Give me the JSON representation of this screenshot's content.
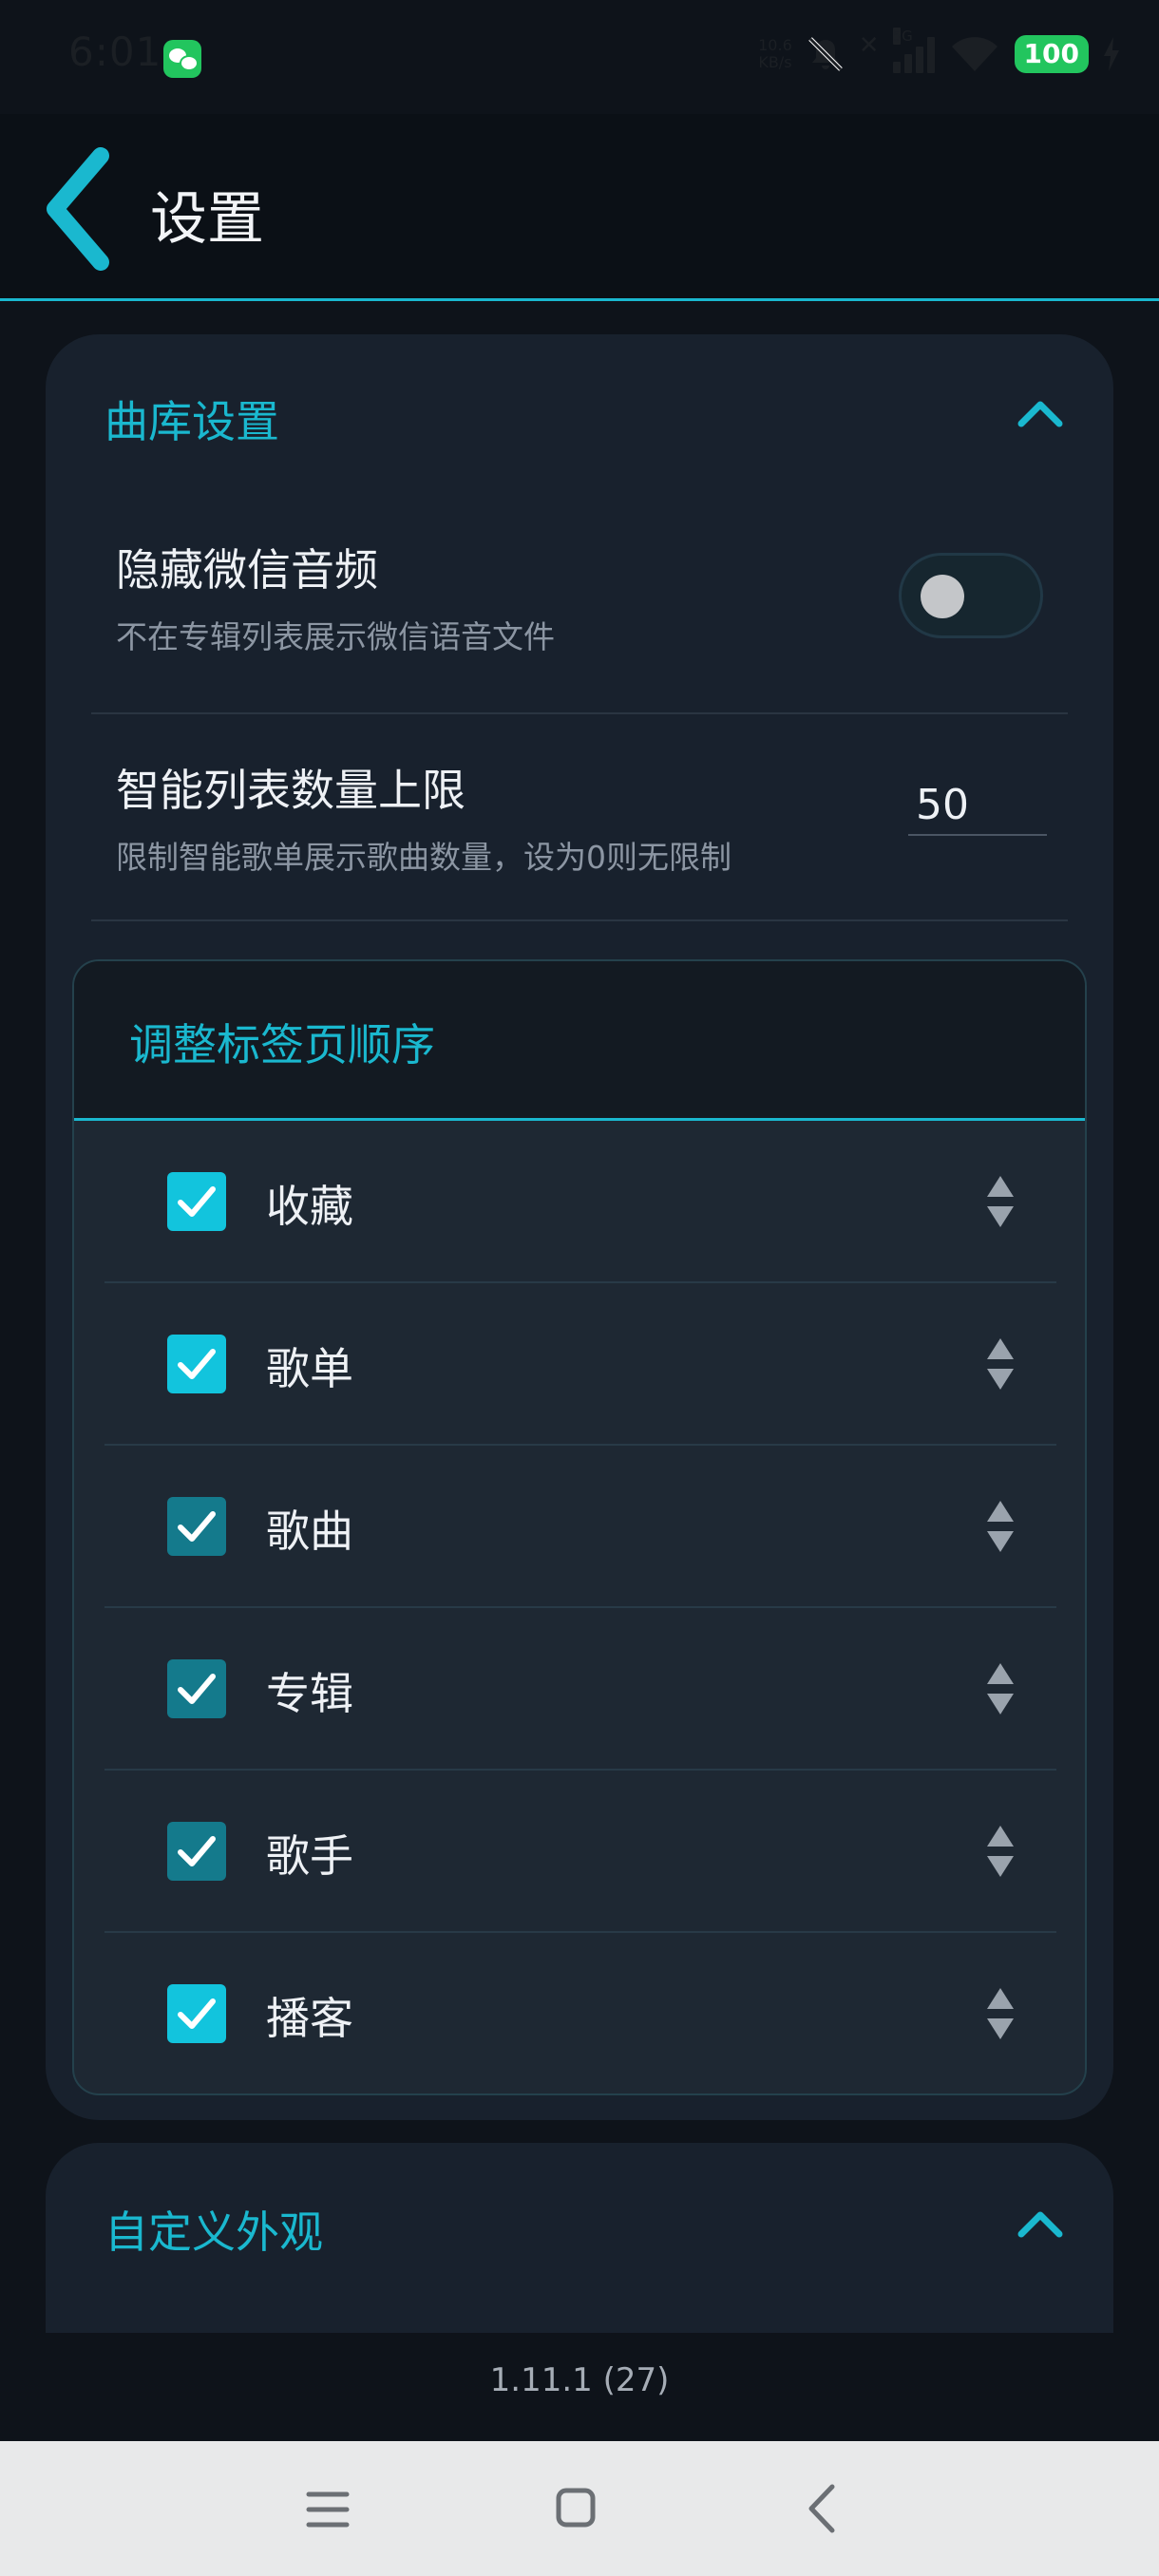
{
  "status_bar": {
    "time": "6:01",
    "speed_value": "10.6",
    "speed_unit": "KB/s",
    "network": "5G",
    "battery": "100"
  },
  "header": {
    "title": "设置"
  },
  "library_settings": {
    "title": "曲库设置",
    "hide_wechat_audio": {
      "title": "隐藏微信音频",
      "description": "不在专辑列表展示微信语音文件",
      "enabled": false
    },
    "smart_list_limit": {
      "title": "智能列表数量上限",
      "description": "限制智能歌单展示歌曲数量，设为0则无限制",
      "value": "50"
    },
    "tab_order": {
      "title": "调整标签页顺序",
      "items": [
        {
          "label": "收藏",
          "checked": true
        },
        {
          "label": "歌单",
          "checked": true
        },
        {
          "label": "歌曲",
          "checked": true
        },
        {
          "label": "专辑",
          "checked": true
        },
        {
          "label": "歌手",
          "checked": true
        },
        {
          "label": "播客",
          "checked": true
        }
      ]
    }
  },
  "appearance": {
    "title": "自定义外观"
  },
  "version": "1.11.1 (27)",
  "colors": {
    "accent": "#1ab8cf",
    "background": "#0e131a",
    "card": "#18212d"
  }
}
